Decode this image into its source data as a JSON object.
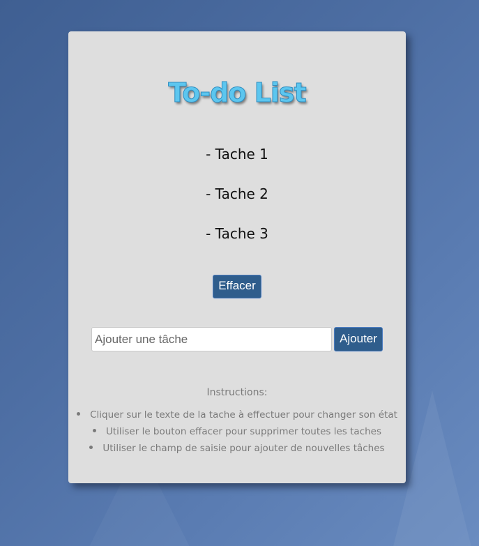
{
  "app": {
    "title": "To-do List"
  },
  "tasks": [
    {
      "label": "- Tache 1"
    },
    {
      "label": "- Tache 2"
    },
    {
      "label": "- Tache 3"
    }
  ],
  "actions": {
    "clear_label": "Effacer",
    "add_label": "Ajouter"
  },
  "input": {
    "value": "",
    "placeholder": "Ajouter une tâche"
  },
  "instructions": {
    "title": "Instructions:",
    "items": [
      "Cliquer sur le texte de la tache à effectuer pour changer son état",
      "Utiliser le bouton effacer pour supprimer toutes les taches",
      "Utiliser le champ de saisie pour ajouter de nouvelles tâches"
    ]
  },
  "colors": {
    "accent_button": "#2f5d8c",
    "title_color": "#5cc6ef",
    "card_background": "#dedede",
    "page_background": "#4d6ea3"
  }
}
